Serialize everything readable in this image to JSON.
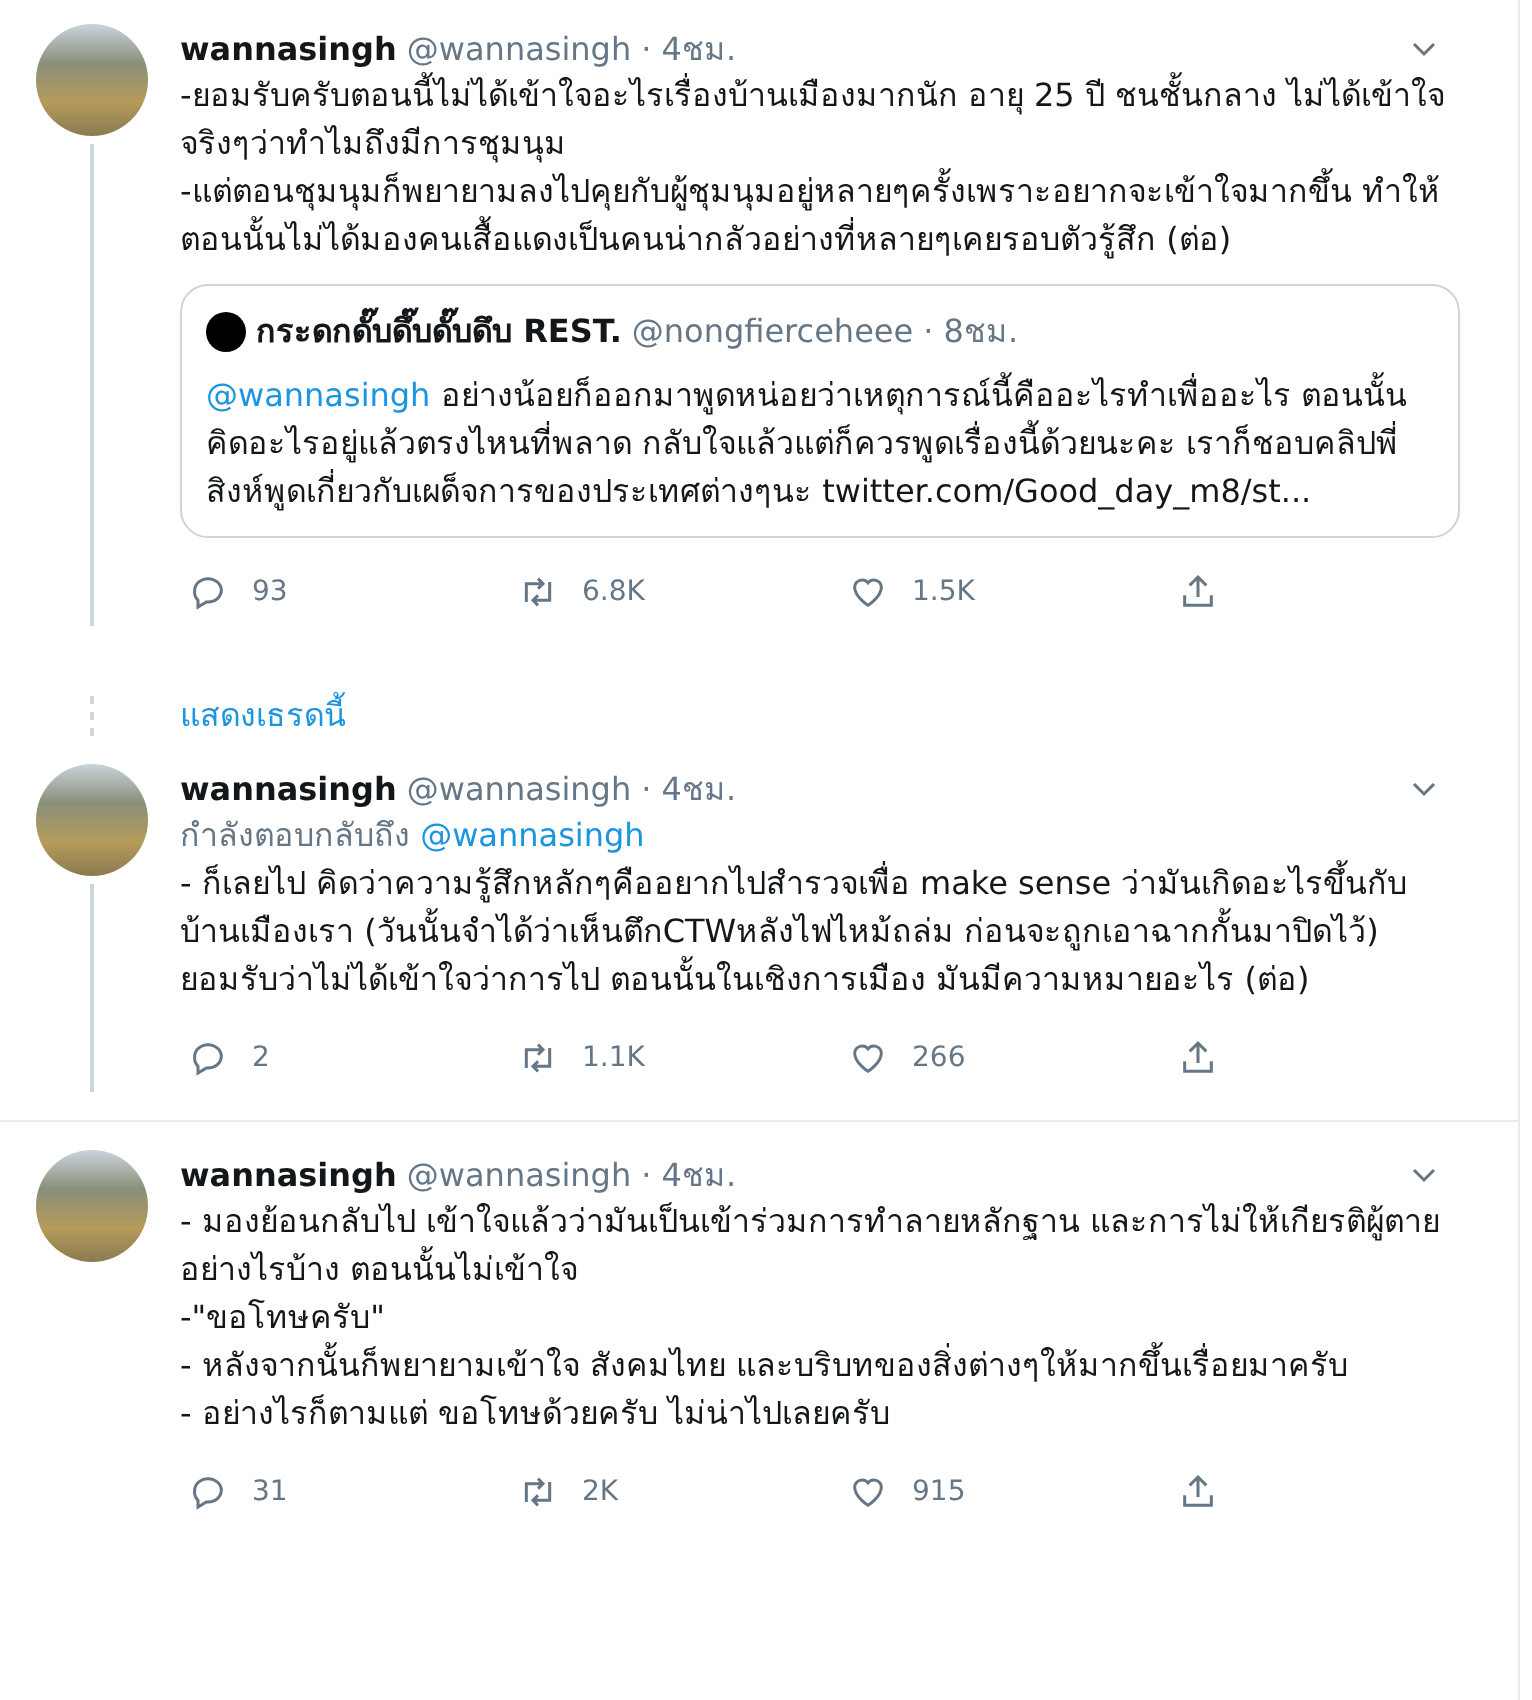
{
  "tweets": [
    {
      "name": "wannasingh",
      "handle": "@wannasingh",
      "time": "· 4ชม.",
      "thread_line": true,
      "paragraphs": [
        "-ยอมรับครับตอนนี้ไม่ได้เข้าใจอะไรเรื่องบ้านเมืองมากนัก อายุ 25 ปี ชนชั้นกลาง ไม่ได้เข้าใจจริงๆว่าทำไมถึงมีการชุมนุม",
        "-แต่ตอนชุมนุมก็พยายามลงไปคุยกับผู้ชุมนุมอยู่หลายๆครั้งเพราะอยากจะเข้าใจมากขึ้น ทำให้ตอนนั้นไม่ได้มองคนเสื้อแดงเป็นคนน่ากลัวอย่างที่หลายๆเคยรอบตัวรู้สึก (ต่อ)"
      ],
      "quote": {
        "name": "กระดกดั๊บดึ๊บดั๊บดึบ REST.",
        "handle": "@nongfierceheee",
        "time": "· 8ชม.",
        "mention": "@wannasingh",
        "text": "อย่างน้อยก็ออกมาพูดหน่อยว่าเหตุการณ์นี้คืออะไรทำเพื่ออะไร ตอนนั้นคิดอะไรอยู่แล้วตรงไหนที่พลาด กลับใจแล้วแต่ก็ควรพูดเรื่องนี้ด้วยนะคะ เราก็ชอบคลิปพี่สิงห์พูดเกี่ยวกับเผด็จการของประเทศต่างๆนะ",
        "link": "twitter.com/Good_day_m8/st..."
      },
      "replies": "93",
      "retweets": "6.8K",
      "likes": "1.5K",
      "show_thread": "แสดงเธรดนี้"
    },
    {
      "name": "wannasingh",
      "handle": "@wannasingh",
      "time": "· 4ชม.",
      "thread_line": true,
      "reply_to": {
        "label": "กำลังตอบกลับถึง",
        "mention": "@wannasingh"
      },
      "paragraphs": [
        "- ก็เลยไป คิดว่าความรู้สึกหลักๆคืออยากไปสำรวจเพื่อ make sense ว่ามันเกิดอะไรขึ้นกับบ้านเมืองเรา (วันนั้นจำได้ว่าเห็นตึกCTWหลังไฟไหม้ถล่ม ก่อนจะถูกเอาฉากกั้นมาปิดไว้) ยอมรับว่าไม่ได้เข้าใจว่าการไป ตอนนั้นในเชิงการเมือง มันมีความหมายอะไร (ต่อ)"
      ],
      "replies": "2",
      "retweets": "1.1K",
      "likes": "266"
    },
    {
      "name": "wannasingh",
      "handle": "@wannasingh",
      "time": "· 4ชม.",
      "thread_line": false,
      "paragraphs": [
        "- มองย้อนกลับไป เข้าใจแล้วว่ามันเป็นเข้าร่วมการทำลายหลักฐาน และการไม่ให้เกียรติผู้ตายอย่างไรบ้าง ตอนนั้นไม่เข้าใจ",
        "-\"ขอโทษครับ\"",
        "- หลังจากนั้นก็พยายามเข้าใจ สังคมไทย และบริบทของสิ่งต่างๆให้มากขึ้นเรื่อยมาครับ",
        "- อย่างไรก็ตามแต่ ขอโทษด้วยครับ ไม่น่าไปเลยครับ"
      ],
      "replies": "31",
      "retweets": "2K",
      "likes": "915"
    }
  ]
}
